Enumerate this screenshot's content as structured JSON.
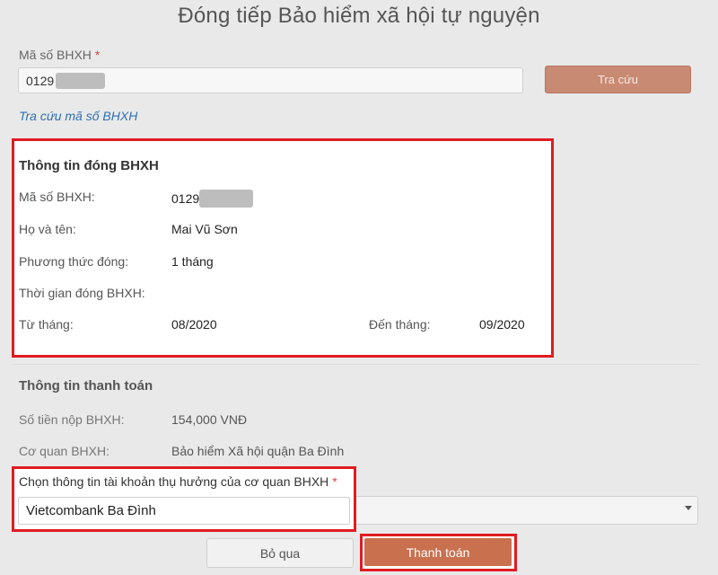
{
  "dialog": {
    "title": "Đóng tiếp Bảo hiểm xã hội tự nguyện"
  },
  "search": {
    "label": "Mã số BHXH",
    "required_mark": "*",
    "input_value_visible": "0129",
    "button_label": "Tra cứu",
    "lookup_link": "Tra cứu mã số BHXH"
  },
  "contribution_info": {
    "title": "Thông tin đóng BHXH",
    "rows": [
      {
        "label": "Mã số BHXH:",
        "value": "0129"
      },
      {
        "label": "Họ và tên:",
        "value": "Mai Vũ Sơn"
      },
      {
        "label": "Phương thức đóng:",
        "value": "1 tháng"
      },
      {
        "label": "Thời gian đóng BHXH:",
        "value": ""
      }
    ],
    "from_label": "Từ tháng:",
    "from_value": "08/2020",
    "to_label": "Đến tháng:",
    "to_value": "09/2020"
  },
  "payment_info": {
    "title": "Thông tin thanh toán",
    "amount_label": "Số tiền nộp BHXH:",
    "amount_value": "154,000 VNĐ",
    "agency_label": "Cơ quan BHXH:",
    "agency_value": "Bảo hiểm Xã hội quận Ba Đình",
    "account_label": "Chọn thông tin tài khoản thụ hưởng của cơ quan BHXH",
    "account_required_mark": "*",
    "account_selected": "Vietcombank Ba Đình"
  },
  "actions": {
    "skip_label": "Bỏ qua",
    "pay_label": "Thanh toán"
  },
  "colors": {
    "highlight": "#e01b22",
    "primary_button": "#c9704f",
    "link": "#2f6fb0"
  }
}
